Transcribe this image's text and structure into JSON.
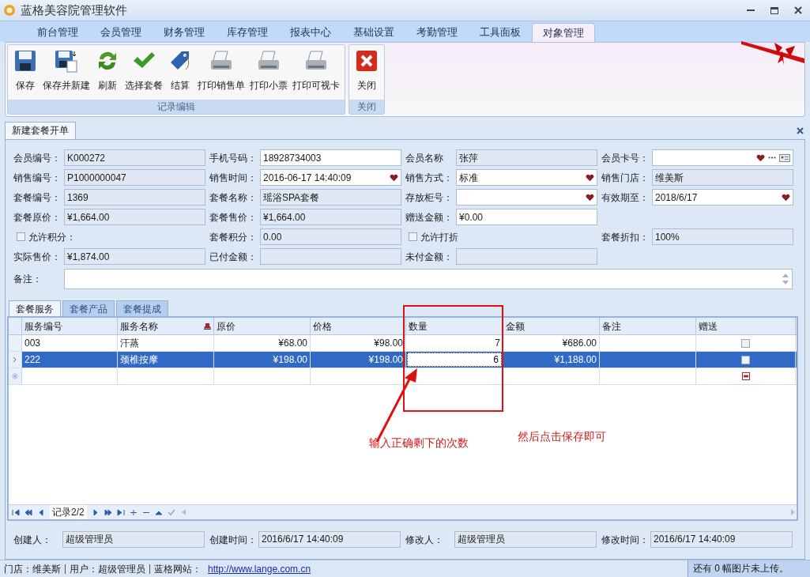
{
  "window": {
    "title": "蓝格美容院管理软件"
  },
  "menu_tabs": [
    {
      "label": "前台管理",
      "selected": false
    },
    {
      "label": "会员管理",
      "selected": false
    },
    {
      "label": "财务管理",
      "selected": false
    },
    {
      "label": "库存管理",
      "selected": false
    },
    {
      "label": "报表中心",
      "selected": false
    },
    {
      "label": "基础设置",
      "selected": false
    },
    {
      "label": "考勤管理",
      "selected": false
    },
    {
      "label": "工具面板",
      "selected": false
    },
    {
      "label": "对象管理",
      "selected": true
    }
  ],
  "ribbon": {
    "groups": [
      {
        "label": "记录编辑",
        "buttons": [
          {
            "label": "保存",
            "kind": "save"
          },
          {
            "label": "保存并新建",
            "kind": "save-new"
          },
          {
            "label": "刷新",
            "kind": "refresh"
          },
          {
            "label": "选择套餐",
            "kind": "check"
          },
          {
            "label": "结算",
            "kind": "tag"
          },
          {
            "label": "打印销售单",
            "kind": "print"
          },
          {
            "label": "打印小票",
            "kind": "print"
          },
          {
            "label": "打印可视卡",
            "kind": "print"
          }
        ]
      },
      {
        "label": "关闭",
        "buttons": [
          {
            "label": "关闭",
            "kind": "close"
          }
        ]
      }
    ]
  },
  "document_tab": {
    "label": "新建套餐开单"
  },
  "form": {
    "rows": [
      [
        {
          "label": "会员编号：",
          "value": "K000272",
          "kind": "readonly"
        },
        {
          "label": "手机号码：",
          "value": "18928734003",
          "kind": "input"
        },
        {
          "label": "会员名称",
          "value": "张萍",
          "kind": "readonly"
        },
        {
          "label": "会员卡号：",
          "kind": "card"
        }
      ],
      [
        {
          "label": "销售编号：",
          "value": "P1000000047",
          "kind": "readonly"
        },
        {
          "label": "销售时间：",
          "value": "2016-06-17 14:40:09",
          "kind": "dropdown"
        },
        {
          "label": "销售方式：",
          "value": "标准",
          "kind": "dropdown"
        },
        {
          "label": "销售门店：",
          "value": "维美斯",
          "kind": "readonly"
        }
      ],
      [
        {
          "label": "套餐编号：",
          "value": "1369",
          "kind": "readonly"
        },
        {
          "label": "套餐名称：",
          "value": "瑶浴SPA套餐",
          "kind": "readonly"
        },
        {
          "label": "存放柜号：",
          "kind": "dropdown"
        },
        {
          "label": "有效期至：",
          "value": "2018/6/17",
          "kind": "dropdown"
        }
      ],
      [
        {
          "label": "套餐原价：",
          "value": "¥1,664.00",
          "kind": "readonly"
        },
        {
          "label": "套餐售价：",
          "value": "¥1,664.00",
          "kind": "readonly"
        },
        {
          "label": "赠送金额：",
          "value": "¥0.00",
          "kind": "input"
        }
      ],
      [
        {
          "label": "允许积分：",
          "kind": "checkbox",
          "checked": false
        },
        {
          "label": "套餐积分：",
          "value": "0.00",
          "kind": "readonly"
        },
        {
          "label": "允许打折",
          "kind": "checkbox",
          "checked": false
        },
        {
          "label": "套餐折扣：",
          "value": "100%",
          "kind": "readonly"
        }
      ],
      [
        {
          "label": "实际售价：",
          "value": "¥1,874.00",
          "kind": "readonly"
        },
        {
          "label": "已付金额：",
          "kind": "readonly"
        },
        {
          "label": "未付金额：",
          "kind": "readonly"
        }
      ]
    ],
    "note": {
      "label": "备注："
    }
  },
  "sub_tabs": [
    {
      "label": "套餐服务",
      "selected": true
    },
    {
      "label": "套餐产品",
      "selected": false
    },
    {
      "label": "套餐提成",
      "selected": false
    }
  ],
  "table": {
    "columns": [
      {
        "label": "服务编号",
        "kind": "text"
      },
      {
        "label": "服务名称",
        "kind": "text",
        "filtered": true
      },
      {
        "label": "原价",
        "kind": "money"
      },
      {
        "label": "价格",
        "kind": "money"
      },
      {
        "label": "数量",
        "kind": "number"
      },
      {
        "label": "金额",
        "kind": "money"
      },
      {
        "label": "备注",
        "kind": "text"
      },
      {
        "label": "赠送",
        "kind": "check"
      }
    ],
    "rows": [
      {
        "kind": "data",
        "selected": false,
        "editing": false,
        "cells": [
          "003",
          "汗蒸",
          "¥68.00",
          "¥98.00",
          "7",
          "¥686.00",
          ""
        ],
        "gift": false
      },
      {
        "kind": "data",
        "selected": true,
        "editing": true,
        "cells": [
          "222",
          "颈椎按摩",
          "¥198.00",
          "¥198.00",
          "6",
          "¥1,188.00",
          ""
        ],
        "gift": false
      },
      {
        "kind": "new",
        "selected": false
      }
    ]
  },
  "navigator": {
    "record": "记录2/2"
  },
  "annotations": [
    {
      "text": "输入正确剩下的次数"
    },
    {
      "text": "然后点击保存即可"
    }
  ],
  "footer": [
    {
      "label": "创建人：",
      "value": "超级管理员"
    },
    {
      "label": "创建时间：",
      "value": "2016/6/17 14:40:09"
    },
    {
      "label": "修改人：",
      "value": "超级管理员"
    },
    {
      "label": "修改时间：",
      "value": "2016/6/17 14:40:09"
    }
  ],
  "status_bar": {
    "items": [
      "门店：维美斯",
      "用户：超级管理员",
      "蓝格网站："
    ],
    "url": "http://www.lange.com.cn",
    "upload": "还有 0 幅图片未上传。"
  }
}
